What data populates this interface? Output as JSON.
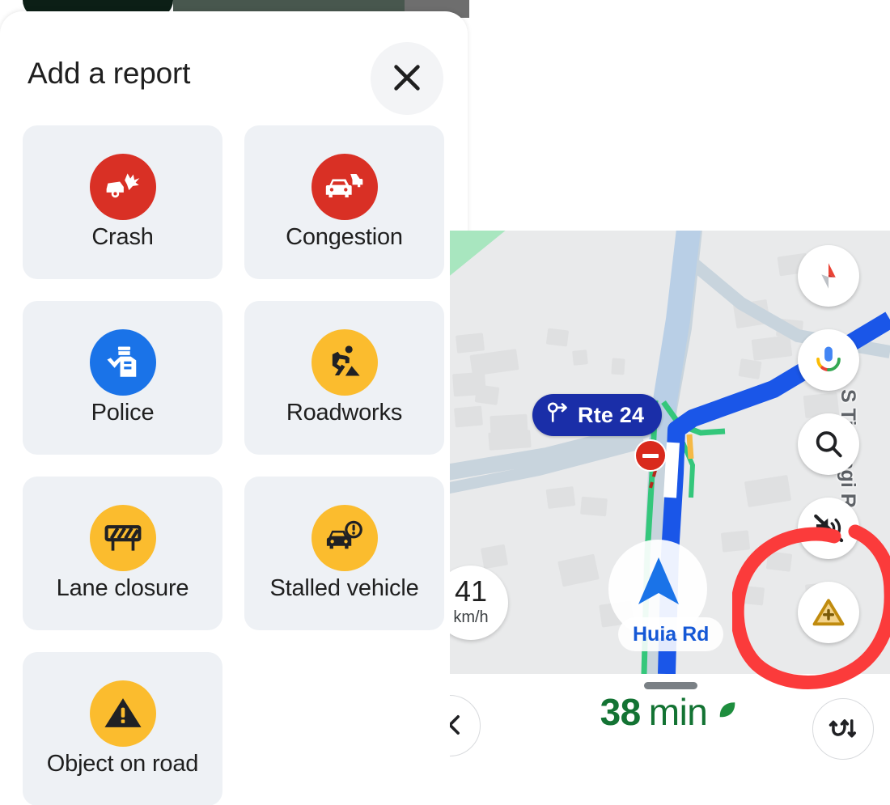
{
  "sheet": {
    "title": "Add a report",
    "close_icon": "close-icon",
    "reports": [
      {
        "label": "Crash",
        "icon": "crash-icon",
        "circle_color": "#d93025",
        "glyph_color": "#ffffff"
      },
      {
        "label": "Congestion",
        "icon": "congestion-icon",
        "circle_color": "#d93025",
        "glyph_color": "#ffffff"
      },
      {
        "label": "Police",
        "icon": "police-icon",
        "circle_color": "#1a73e8",
        "glyph_color": "#ffffff"
      },
      {
        "label": "Roadworks",
        "icon": "roadworks-icon",
        "circle_color": "#fbbc2e",
        "glyph_color": "#202124"
      },
      {
        "label": "Lane closure",
        "icon": "lane-closure-icon",
        "circle_color": "#fbbc2e",
        "glyph_color": "#202124"
      },
      {
        "label": "Stalled vehicle",
        "icon": "stalled-vehicle-icon",
        "circle_color": "#fbbc2e",
        "glyph_color": "#202124"
      },
      {
        "label": "Object on road",
        "icon": "object-on-road-icon",
        "circle_color": "#fbbc2e",
        "glyph_color": "#202124"
      }
    ]
  },
  "map": {
    "route_badge": {
      "label": "Rte 24",
      "icon": "roundabout-exit-icon"
    },
    "speed": {
      "value": "41",
      "unit": "km/h"
    },
    "street_labels": {
      "primary": "Huia Rd",
      "secondary": "S Titirangi R"
    },
    "controls": [
      {
        "name": "compass-button",
        "icon": "compass-icon"
      },
      {
        "name": "assistant-button",
        "icon": "microphone-icon"
      },
      {
        "name": "search-button",
        "icon": "search-icon"
      },
      {
        "name": "mute-button",
        "icon": "mute-icon"
      },
      {
        "name": "report-button",
        "icon": "report-triangle-plus-icon"
      }
    ],
    "route_color": "#1a56e8",
    "park_color": "#a8e6bf"
  },
  "bottom_bar": {
    "eta_value": "38",
    "eta_unit": "min",
    "eco_icon": "eco-leaf-icon",
    "eta_color": "#137333",
    "close_icon": "close-icon",
    "routes_icon": "alternate-routes-icon"
  },
  "annotation": {
    "shape": "hand-drawn-circle",
    "color": "#fb3b3b",
    "target": "report-button"
  }
}
